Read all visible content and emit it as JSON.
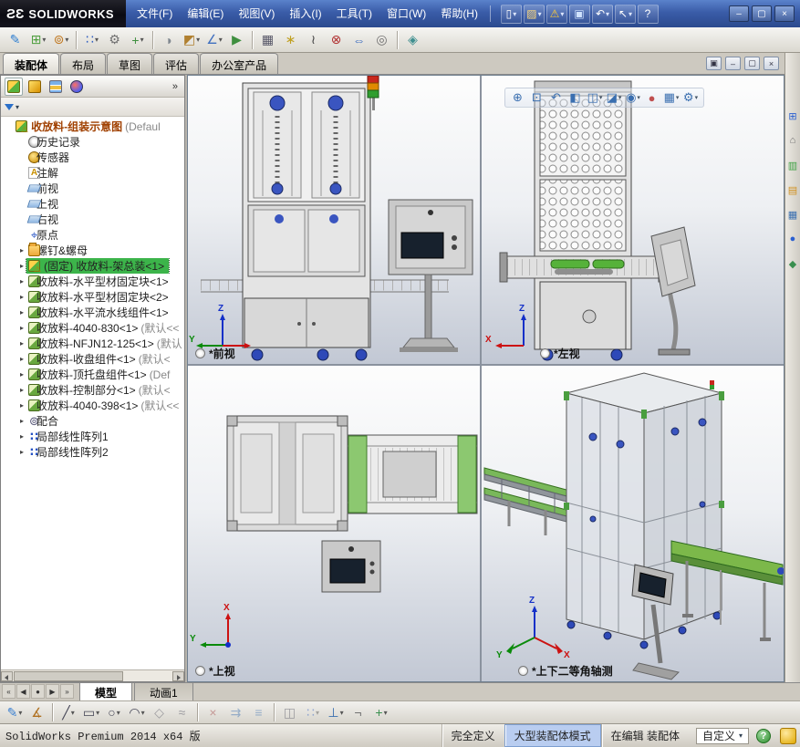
{
  "window": {
    "logo_mark": "ЗS",
    "logo_text": "SOLIDWORKS",
    "controls": [
      {
        "name": "minimize-button",
        "glyph": "–"
      },
      {
        "name": "maximize-button",
        "glyph": "▢"
      },
      {
        "name": "close-button",
        "glyph": "×"
      }
    ]
  },
  "menubar": {
    "items": [
      "文件(F)",
      "编辑(E)",
      "视图(V)",
      "插入(I)",
      "工具(T)",
      "窗口(W)",
      "帮助(H)"
    ]
  },
  "quickbar": {
    "items": [
      {
        "name": "new-document-button",
        "glyph": "▯",
        "c": "#ffffff",
        "caret": "▾"
      },
      {
        "name": "open-document-button",
        "glyph": "▨",
        "c": "#ffd97a",
        "caret": "▾"
      },
      {
        "name": "rebuild-button",
        "glyph": "⚠",
        "c": "#ffcc33",
        "caret": "▾"
      },
      {
        "name": "save-button",
        "glyph": "▣",
        "c": "#cfe2ff"
      },
      {
        "name": "undo-button",
        "glyph": "↶",
        "c": "#ffffff",
        "caret": "▾"
      },
      {
        "name": "select-button",
        "glyph": "↖",
        "c": "#ffffff",
        "caret": "▾"
      },
      {
        "name": "help-button",
        "glyph": "?",
        "c": "#ffffff"
      }
    ]
  },
  "toolbar": {
    "items": [
      {
        "name": "edit-component-button",
        "glyph": "✎",
        "c": "#2f7fd0"
      },
      {
        "name": "insert-components-button",
        "glyph": "⊞",
        "c": "#4f9f3f",
        "caret": "▾"
      },
      {
        "name": "mate-button",
        "glyph": "⊚",
        "c": "#c07820",
        "caret": "▾"
      },
      {
        "name": "toolbar-separator",
        "cls": "sepv"
      },
      {
        "name": "linear-component-pattern-button",
        "glyph": "∷",
        "c": "#2f5fc0",
        "caret": "▾"
      },
      {
        "name": "smart-fasteners-button",
        "glyph": "⚙",
        "c": "#707070"
      },
      {
        "name": "move-component-button",
        "glyph": "+",
        "c": "#3f8f3f",
        "caret": "▾"
      },
      {
        "name": "toolbar-separator",
        "cls": "sepv"
      },
      {
        "name": "show-hidden-components-button",
        "glyph": "◑",
        "c": "#808890"
      },
      {
        "name": "assembly-features-button",
        "glyph": "◩",
        "c": "#b08030",
        "caret": "▾"
      },
      {
        "name": "reference-geometry-button",
        "glyph": "∠",
        "c": "#3f6fbf",
        "caret": "▾"
      },
      {
        "name": "new-motion-study-button",
        "glyph": "▶",
        "c": "#3f8f3f"
      },
      {
        "name": "toolbar-separator",
        "cls": "sepv"
      },
      {
        "name": "bill-of-materials-button",
        "glyph": "▦",
        "c": "#556"
      },
      {
        "name": "exploded-view-button",
        "glyph": "∗",
        "c": "#c0a020"
      },
      {
        "name": "explode-line-sketch-button",
        "glyph": "≀",
        "c": "#444"
      },
      {
        "name": "interference-detection-button",
        "glyph": "⊗",
        "c": "#b03030"
      },
      {
        "name": "clearance-verification-button",
        "glyph": "⇔",
        "c": "#3f6fbf"
      },
      {
        "name": "hole-alignment-button",
        "glyph": "◎",
        "c": "#707070"
      },
      {
        "name": "toolbar-separator",
        "cls": "sepv"
      },
      {
        "name": "instant-3d-button",
        "glyph": "◈",
        "c": "#3f8f8f"
      }
    ]
  },
  "command_tabs": {
    "items": [
      {
        "label": "装配体",
        "cls": "active"
      },
      {
        "label": "布局"
      },
      {
        "label": "草图"
      },
      {
        "label": "评估"
      },
      {
        "label": "办公室产品"
      }
    ]
  },
  "panel": {
    "tabs": [
      {
        "name": "featuremanager-tab",
        "icon": "fm",
        "cls": "active"
      },
      {
        "name": "propertymanager-tab",
        "icon": "pm"
      },
      {
        "name": "configurationmanager-tab",
        "icon": "cfg"
      },
      {
        "name": "displaymanager-tab",
        "icon": "dm"
      }
    ],
    "expand": "»",
    "filter_caret": "▾"
  },
  "tree": {
    "items": [
      {
        "icon": "assembly",
        "warn": "⚠",
        "label": "收放料-组装示意图 ",
        "suffix": "(Defaul",
        "cls": "root"
      },
      {
        "icon": "history",
        "label": "历史记录",
        "cls": "ind1"
      },
      {
        "icon": "sensors",
        "label": "传感器",
        "cls": "ind1"
      },
      {
        "icon": "annotations",
        "label": "注解",
        "cls": "ind1"
      },
      {
        "icon": "plane",
        "label": "前视",
        "cls": "ind1"
      },
      {
        "icon": "plane",
        "label": "上视",
        "cls": "ind1"
      },
      {
        "icon": "plane",
        "label": "右视",
        "cls": "ind1"
      },
      {
        "icon": "origin",
        "label": "原点",
        "cls": "ind1"
      },
      {
        "exp": "▸",
        "icon": "folder",
        "label": "螺钉&螺母",
        "cls": "ind1"
      },
      {
        "exp": "▸",
        "icon": "assembly",
        "warn": "⚠",
        "label": "(固定) 收放料-架总装<1>",
        "cls": "ind1 sel"
      },
      {
        "exp": "▸",
        "icon": "component",
        "label": "收放料-水平型材固定块<1>",
        "cls": "ind1"
      },
      {
        "exp": "▸",
        "icon": "component",
        "label": "收放料-水平型材固定块<2>",
        "cls": "ind1"
      },
      {
        "exp": "▸",
        "icon": "component",
        "label": "收放料-水平流水线组件<1>",
        "cls": "ind1"
      },
      {
        "exp": "▸",
        "icon": "component",
        "label": "收放料-4040-830<1>",
        "suffix": "(默认<<",
        "cls": "ind1"
      },
      {
        "exp": "▸",
        "icon": "component",
        "label": "收放料-NFJN12-125<1>",
        "suffix": "(默认",
        "cls": "ind1"
      },
      {
        "exp": "▸",
        "icon": "component",
        "label": "收放料-收盘组件<1>",
        "suffix": "(默认<",
        "cls": "ind1"
      },
      {
        "exp": "▸",
        "icon": "component",
        "label": "收放料-顶托盘组件<1>",
        "suffix": "(Def",
        "cls": "ind1"
      },
      {
        "exp": "▸",
        "icon": "component",
        "label": "收放料-控制部分<1>",
        "suffix": "(默认<",
        "cls": "ind1"
      },
      {
        "exp": "▸",
        "icon": "component",
        "label": "收放料-4040-398<1>",
        "suffix": "(默认<<",
        "cls": "ind1"
      },
      {
        "exp": "▸",
        "icon": "mates",
        "label": "配合",
        "cls": "ind1"
      },
      {
        "exp": "▸",
        "icon": "pattern",
        "label": "局部线性阵列1",
        "cls": "ind1"
      },
      {
        "exp": "▸",
        "icon": "pattern",
        "label": "局部线性阵列2",
        "cls": "ind1"
      }
    ]
  },
  "viewports": {
    "front": {
      "label": "*前视"
    },
    "left": {
      "label": "*左视"
    },
    "top": {
      "label": "*上视"
    },
    "iso": {
      "label": "*上下二等角轴测"
    },
    "window_buttons": [
      {
        "name": "viewport-restore-button",
        "glyph": "▣"
      },
      {
        "name": "viewport-minimize-button",
        "glyph": "–"
      },
      {
        "name": "viewport-maximize-button",
        "glyph": "▢"
      },
      {
        "name": "viewport-close-button",
        "glyph": "×"
      }
    ],
    "hud": [
      {
        "name": "zoom-fit-button",
        "glyph": "⊕",
        "c": "#3a6fb0"
      },
      {
        "name": "zoom-area-button",
        "glyph": "⊡",
        "c": "#3a6fb0"
      },
      {
        "name": "previous-view-button",
        "glyph": "↶",
        "c": "#3a6fb0"
      },
      {
        "name": "section-view-button",
        "glyph": "◧",
        "c": "#3a6fb0"
      },
      {
        "name": "view-orientation-button",
        "glyph": "◫",
        "c": "#3a6fb0",
        "caret": "▾"
      },
      {
        "name": "display-style-button",
        "glyph": "◪",
        "c": "#3a6fb0",
        "caret": "▾"
      },
      {
        "name": "hide-show-items-button",
        "glyph": "◉",
        "c": "#3a6fb0",
        "caret": "▾"
      },
      {
        "name": "edit-appearance-button",
        "glyph": "●",
        "c": "#c05050"
      },
      {
        "name": "apply-scene-button",
        "glyph": "▦",
        "c": "#3a6fb0",
        "caret": "▾"
      },
      {
        "name": "view-settings-button",
        "glyph": "⚙",
        "c": "#3a6fb0",
        "caret": "▾"
      }
    ]
  },
  "taskpane": {
    "items": [
      {
        "name": "toolbox-icon",
        "glyph": "⊞",
        "c": "#2a5fd0"
      },
      {
        "name": "solidworks-resources-icon",
        "glyph": "⌂",
        "c": "#707070"
      },
      {
        "name": "xpress-products-icon",
        "glyph": "▥",
        "c": "#3a9f3f"
      },
      {
        "name": "design-library-icon",
        "glyph": "▤",
        "c": "#d09020"
      },
      {
        "name": "view-palette-icon",
        "glyph": "▦",
        "c": "#3a6fb0"
      },
      {
        "name": "appearances-scenes-icon",
        "glyph": "●",
        "c": "#2a5fd0"
      },
      {
        "name": "custom-properties-icon",
        "glyph": "◆",
        "c": "#3a8f4f"
      }
    ]
  },
  "model_tabs": {
    "nav": [
      {
        "name": "scroll-first-button",
        "glyph": "«"
      },
      {
        "name": "scroll-prev-button",
        "glyph": "◀"
      },
      {
        "name": "scroll-dot-button",
        "glyph": "●"
      },
      {
        "name": "scroll-next-button",
        "glyph": "▶"
      },
      {
        "name": "scroll-last-button",
        "glyph": "»"
      }
    ],
    "items": [
      {
        "label": "模型",
        "cls": "active"
      },
      {
        "label": "动画1"
      }
    ]
  },
  "sketchbar": {
    "items": [
      {
        "name": "sketch-button",
        "glyph": "✎",
        "c": "#3a7fd0",
        "caret": "▾"
      },
      {
        "name": "smart-dimension-button",
        "glyph": "∡",
        "c": "#b07020"
      },
      {
        "name": "toolbar-separator",
        "cls": "sepv"
      },
      {
        "name": "line-button",
        "glyph": "╱",
        "c": "#445",
        "caret": "▾"
      },
      {
        "name": "rectangle-button",
        "glyph": "▭",
        "c": "#445",
        "caret": "▾"
      },
      {
        "name": "circle-button",
        "glyph": "○",
        "c": "#445",
        "caret": "▾"
      },
      {
        "name": "arc-button",
        "glyph": "◠",
        "c": "#445",
        "caret": "▾"
      },
      {
        "name": "polygon-button",
        "glyph": "◇",
        "c": "#445",
        "cls": "dis"
      },
      {
        "name": "spline-button",
        "glyph": "≈",
        "c": "#445",
        "cls": "dis"
      },
      {
        "name": "toolbar-separator",
        "cls": "sepv"
      },
      {
        "name": "trim-entities-button",
        "glyph": "×",
        "c": "#a04040",
        "cls": "dis"
      },
      {
        "name": "convert-entities-button",
        "glyph": "⇉",
        "c": "#3a6fb0",
        "cls": "dis"
      },
      {
        "name": "offset-entities-button",
        "glyph": "≡",
        "c": "#3a6fb0",
        "cls": "dis"
      },
      {
        "name": "toolbar-separator",
        "cls": "sepv"
      },
      {
        "name": "mirror-entities-button",
        "glyph": "◫",
        "c": "#445",
        "cls": "dis"
      },
      {
        "name": "linear-sketch-pattern-button",
        "glyph": "∷",
        "c": "#2f5fc0",
        "cls": "dis",
        "caret": "▾"
      },
      {
        "name": "display-relations-button",
        "glyph": "⊥",
        "c": "#3a6fb0",
        "caret": "▾"
      },
      {
        "name": "repair-sketch-button",
        "glyph": "¬",
        "c": "#707070"
      },
      {
        "name": "quick-snaps-button",
        "glyph": "+",
        "c": "#3a8f4f",
        "caret": "▾"
      }
    ]
  },
  "statusbar": {
    "left": "SolidWorks Premium 2014 x64 版",
    "segments": [
      {
        "label": "完全定义"
      },
      {
        "label": "大型装配体模式",
        "cls": "hl"
      },
      {
        "label": "在编辑 装配体"
      }
    ],
    "custom_label": "自定义",
    "custom_caret": "▾",
    "help": "?"
  },
  "axes": {
    "x": "X",
    "y": "Y",
    "z": "Z"
  }
}
